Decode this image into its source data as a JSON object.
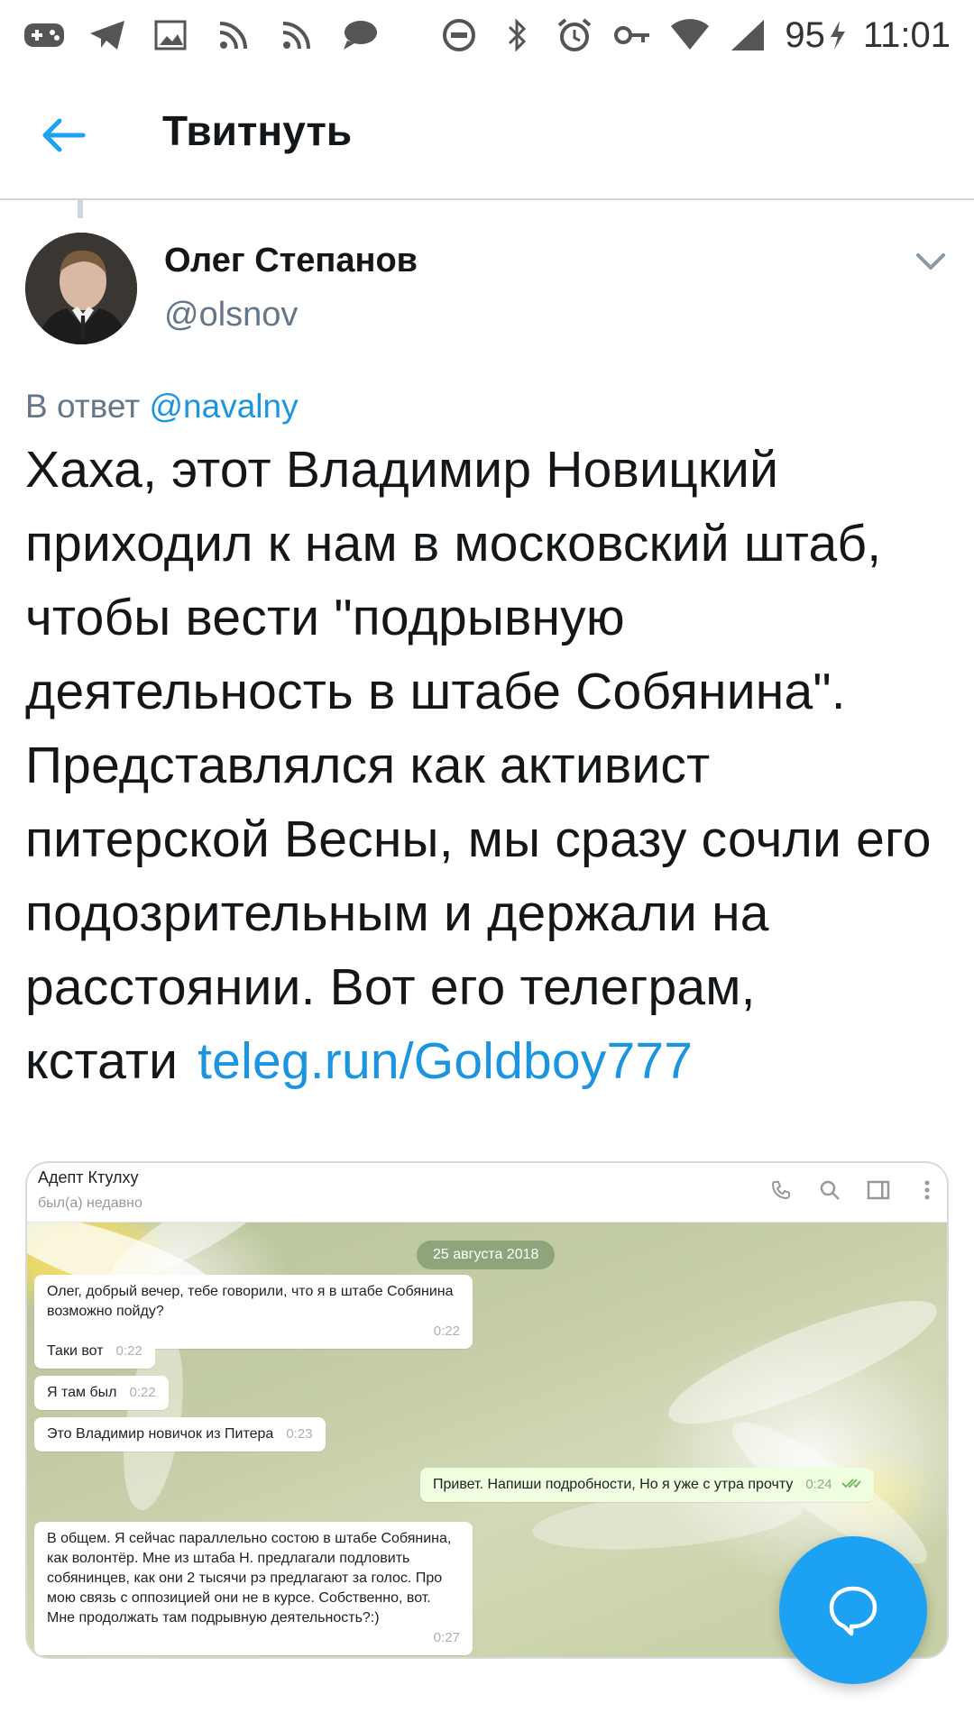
{
  "status_bar": {
    "battery": "95",
    "time": "11:01",
    "left_icons": [
      "gamepad-icon",
      "telegram-icon",
      "image-icon",
      "rss-icon",
      "rss-icon",
      "chat-icon"
    ],
    "right_icons": [
      "do-not-disturb-icon",
      "bluetooth-icon",
      "alarm-icon",
      "key-icon",
      "wifi-icon",
      "signal-icon",
      "battery-charging-icon"
    ]
  },
  "header": {
    "title": "Твитнуть"
  },
  "tweet": {
    "author_name": "Олег Степанов",
    "author_handle": "@olsnov",
    "reply_prefix": "В ответ",
    "reply_mention": "@navalny",
    "text": "Хаха, этот Владимир Новицкий приходил к нам в московский штаб, чтобы вести \"подрывную деятельность в штабе Собянина\". Представлялся как активист питерской Весны, мы сразу сочли его подозрительным и держали на расстоянии. Вот его телеграм, кстати",
    "link": "teleg.run/Goldboy777"
  },
  "media": {
    "chat_name": "Адепт Ктулху",
    "chat_status": "был(а) недавно",
    "date": "25 августа 2018",
    "messages": [
      {
        "text": "Олег, добрый вечер, тебе говорили, что я в штабе Собянина возможно пойду?",
        "time": "0:22",
        "outgoing": false
      },
      {
        "text": "Таки вот",
        "time": "0:22",
        "outgoing": false
      },
      {
        "text": "Я там был",
        "time": "0:22",
        "outgoing": false
      },
      {
        "text": "Это Владимир новичок из Питера",
        "time": "0:23",
        "outgoing": false
      },
      {
        "text": "Привет. Напиши подробности, Но я уже с утра прочту",
        "time": "0:24",
        "outgoing": true
      },
      {
        "text": "В общем. Я сейчас параллельно состою в штабе Собянина, как волонтёр. Мне из штаба Н. предлагали подловить собянинцев, как они 2 тысячи рэ предлагают за голос. Про мою связь с оппозицией они не в курсе. Собственно, вот. Мне продолжать там подрывную деятельность?:)",
        "time": "0:27",
        "outgoing": false
      }
    ]
  },
  "colors": {
    "accent": "#1da1f2",
    "link": "#1b95e0",
    "secondary_text": "#657786"
  }
}
